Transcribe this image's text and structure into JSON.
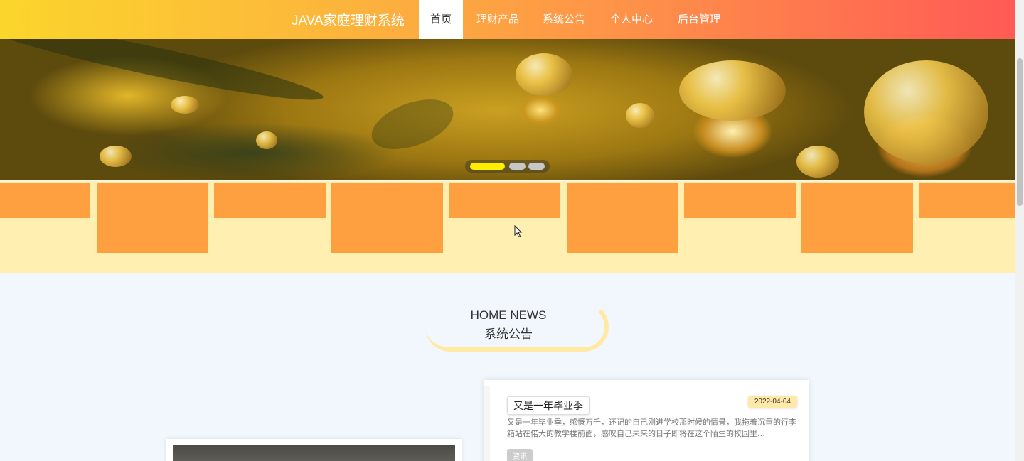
{
  "nav": {
    "brand": "JAVA家庭理财系统",
    "items": [
      {
        "label": "首页",
        "active": true
      },
      {
        "label": "理财产品",
        "active": false
      },
      {
        "label": "系统公告",
        "active": false
      },
      {
        "label": "个人中心",
        "active": false
      },
      {
        "label": "后台管理",
        "active": false
      }
    ]
  },
  "carousel": {
    "slide_count": 3,
    "active_index": 0
  },
  "news_section": {
    "heading_en": "HOME NEWS",
    "heading_zh": "系统公告"
  },
  "news": [
    {
      "title": "又是一年毕业季",
      "date": "2022-04-04",
      "excerpt": "又是一年毕业季，感慨万千，还记的自己刚进学校那时候的情景，我拖着沉重的行李箱站在偌大的教学楼前面，感叹自己未来的日子即将在这个陌生的校园里…",
      "tag": "资讯"
    }
  ],
  "colors": {
    "nav_gradient_start": "#fbd52c",
    "nav_gradient_end": "#ff5a55",
    "tile": "#ffa040",
    "feature_band": "#ffefb0",
    "page_bg": "#f1f7fd",
    "active_dot": "#ffee00"
  }
}
